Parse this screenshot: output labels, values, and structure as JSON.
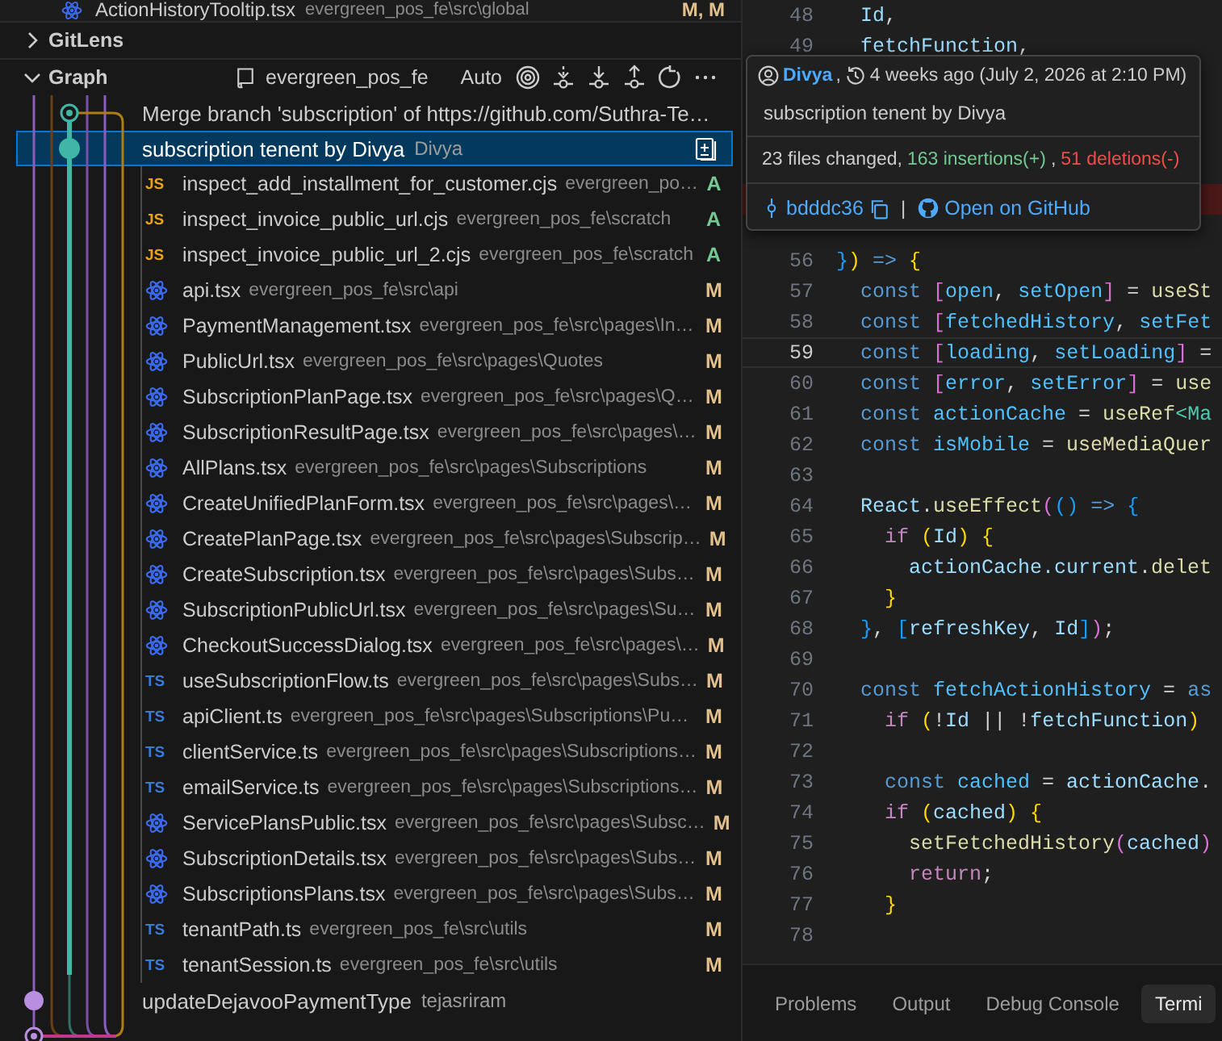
{
  "top_file": {
    "name": "ActionHistoryTooltip.tsx",
    "path": "evergreen_pos_fe\\src\\global",
    "status": "M, M"
  },
  "sections": [
    {
      "title": "GitLens",
      "expanded": false
    },
    {
      "title": "Graph",
      "expanded": true
    }
  ],
  "graph_toolbar": {
    "repo": "evergreen_pos_fe",
    "mode": "Auto"
  },
  "commits": [
    {
      "message": "Merge branch 'subscription' of https://github.com/Suthra-Te…",
      "selected": false
    },
    {
      "message": "subscription tenent by Divya",
      "author": "Divya",
      "selected": true,
      "files": [
        {
          "kind": "js",
          "badge": "JS",
          "name": "inspect_add_installment_for_customer.cjs",
          "path": "evergreen_po…",
          "status": "A"
        },
        {
          "kind": "js",
          "badge": "JS",
          "name": "inspect_invoice_public_url.cjs",
          "path": "evergreen_pos_fe\\scratch",
          "status": "A"
        },
        {
          "kind": "js",
          "badge": "JS",
          "name": "inspect_invoice_public_url_2.cjs",
          "path": "evergreen_pos_fe\\scratch",
          "status": "A"
        },
        {
          "kind": "react",
          "name": "api.tsx",
          "path": "evergreen_pos_fe\\src\\api",
          "status": "M"
        },
        {
          "kind": "react",
          "name": "PaymentManagement.tsx",
          "path": "evergreen_pos_fe\\src\\pages\\In…",
          "status": "M"
        },
        {
          "kind": "react",
          "name": "PublicUrl.tsx",
          "path": "evergreen_pos_fe\\src\\pages\\Quotes",
          "status": "M"
        },
        {
          "kind": "react",
          "name": "SubscriptionPlanPage.tsx",
          "path": "evergreen_pos_fe\\src\\pages\\Q…",
          "status": "M"
        },
        {
          "kind": "react",
          "name": "SubscriptionResultPage.tsx",
          "path": "evergreen_pos_fe\\src\\pages\\…",
          "status": "M"
        },
        {
          "kind": "react",
          "name": "AllPlans.tsx",
          "path": "evergreen_pos_fe\\src\\pages\\Subscriptions",
          "status": "M"
        },
        {
          "kind": "react",
          "name": "CreateUnifiedPlanForm.tsx",
          "path": "evergreen_pos_fe\\src\\pages\\…",
          "status": "M"
        },
        {
          "kind": "react",
          "name": "CreatePlanPage.tsx",
          "path": "evergreen_pos_fe\\src\\pages\\Subscrip…",
          "status": "M"
        },
        {
          "kind": "react",
          "name": "CreateSubscription.tsx",
          "path": "evergreen_pos_fe\\src\\pages\\Subs…",
          "status": "M"
        },
        {
          "kind": "react",
          "name": "SubscriptionPublicUrl.tsx",
          "path": "evergreen_pos_fe\\src\\pages\\Su…",
          "status": "M"
        },
        {
          "kind": "react",
          "name": "CheckoutSuccessDialog.tsx",
          "path": "evergreen_pos_fe\\src\\pages\\…",
          "status": "M"
        },
        {
          "kind": "ts",
          "badge": "TS",
          "name": "useSubscriptionFlow.ts",
          "path": "evergreen_pos_fe\\src\\pages\\Subs…",
          "status": "M"
        },
        {
          "kind": "ts",
          "badge": "TS",
          "name": "apiClient.ts",
          "path": "evergreen_pos_fe\\src\\pages\\Subscriptions\\Pu…",
          "status": "M"
        },
        {
          "kind": "ts",
          "badge": "TS",
          "name": "clientService.ts",
          "path": "evergreen_pos_fe\\src\\pages\\Subscriptions…",
          "status": "M"
        },
        {
          "kind": "ts",
          "badge": "TS",
          "name": "emailService.ts",
          "path": "evergreen_pos_fe\\src\\pages\\Subscriptions…",
          "status": "M"
        },
        {
          "kind": "react",
          "name": "ServicePlansPublic.tsx",
          "path": "evergreen_pos_fe\\src\\pages\\Subsc…",
          "status": "M"
        },
        {
          "kind": "react",
          "name": "SubscriptionDetails.tsx",
          "path": "evergreen_pos_fe\\src\\pages\\Subs…",
          "status": "M"
        },
        {
          "kind": "react",
          "name": "SubscriptionsPlans.tsx",
          "path": "evergreen_pos_fe\\src\\pages\\Subs…",
          "status": "M"
        },
        {
          "kind": "ts",
          "badge": "TS",
          "name": "tenantPath.ts",
          "path": "evergreen_pos_fe\\src\\utils",
          "status": "M"
        },
        {
          "kind": "ts",
          "badge": "TS",
          "name": "tenantSession.ts",
          "path": "evergreen_pos_fe\\src\\utils",
          "status": "M"
        }
      ]
    },
    {
      "message": "updateDejavooPaymentType",
      "author": "tejasriram",
      "selected": false
    }
  ],
  "editor": {
    "lines_before": [
      {
        "number": "48",
        "code": [
          {
            "text": "  Id",
            "kind": "var"
          },
          {
            "text": ",",
            "kind": "p"
          }
        ]
      },
      {
        "number": "49",
        "code": [
          {
            "text": "  fetchFunction",
            "kind": "var"
          },
          {
            "text": ",",
            "kind": "p"
          }
        ]
      }
    ],
    "covered_lines": [
      {
        "deleted": false
      },
      {
        "deleted": false
      },
      {
        "deleted": false
      },
      {
        "deleted": false
      },
      {
        "deleted": true
      },
      {
        "deleted": false
      }
    ],
    "lines_after": [
      {
        "number": "56",
        "current": false,
        "code": [
          {
            "text": "}",
            "kind": "b3"
          },
          {
            "text": ")",
            "kind": "b1"
          },
          {
            "text": " => ",
            "kind": "kw"
          },
          {
            "text": "{",
            "kind": "b1"
          }
        ]
      },
      {
        "number": "57",
        "current": false,
        "code": [
          {
            "text": "  const ",
            "kind": "kw"
          },
          {
            "text": "[",
            "kind": "b2"
          },
          {
            "text": "open",
            "kind": "cv"
          },
          {
            "text": ", ",
            "kind": "p"
          },
          {
            "text": "setOpen",
            "kind": "cv"
          },
          {
            "text": "]",
            "kind": "b2"
          },
          {
            "text": " = ",
            "kind": "p"
          },
          {
            "text": "useSt",
            "kind": "fn"
          }
        ]
      },
      {
        "number": "58",
        "current": false,
        "code": [
          {
            "text": "  const ",
            "kind": "kw"
          },
          {
            "text": "[",
            "kind": "b2"
          },
          {
            "text": "fetchedHistory",
            "kind": "cv"
          },
          {
            "text": ", ",
            "kind": "p"
          },
          {
            "text": "setFet",
            "kind": "cv"
          }
        ]
      },
      {
        "number": "59",
        "current": true,
        "code": [
          {
            "text": "  const ",
            "kind": "kw"
          },
          {
            "text": "[",
            "kind": "b2"
          },
          {
            "text": "loading",
            "kind": "cv"
          },
          {
            "text": ", ",
            "kind": "p"
          },
          {
            "text": "setLoading",
            "kind": "cv"
          },
          {
            "text": "]",
            "kind": "b2"
          },
          {
            "text": " =",
            "kind": "p"
          }
        ]
      },
      {
        "number": "60",
        "current": false,
        "code": [
          {
            "text": "  const ",
            "kind": "kw"
          },
          {
            "text": "[",
            "kind": "b2"
          },
          {
            "text": "error",
            "kind": "cv"
          },
          {
            "text": ", ",
            "kind": "p"
          },
          {
            "text": "setError",
            "kind": "cv"
          },
          {
            "text": "]",
            "kind": "b2"
          },
          {
            "text": " = ",
            "kind": "p"
          },
          {
            "text": "use",
            "kind": "fn"
          }
        ]
      },
      {
        "number": "61",
        "current": false,
        "code": [
          {
            "text": "  const ",
            "kind": "kw"
          },
          {
            "text": "actionCache",
            "kind": "cv"
          },
          {
            "text": " = ",
            "kind": "p"
          },
          {
            "text": "useRef",
            "kind": "fn"
          },
          {
            "text": "<Ma",
            "kind": "ty"
          }
        ]
      },
      {
        "number": "62",
        "current": false,
        "code": [
          {
            "text": "  const ",
            "kind": "kw"
          },
          {
            "text": "isMobile",
            "kind": "cv"
          },
          {
            "text": " = ",
            "kind": "p"
          },
          {
            "text": "useMediaQuer",
            "kind": "fn"
          }
        ]
      },
      {
        "number": "63",
        "current": false
      },
      {
        "number": "64",
        "current": false,
        "code": [
          {
            "text": "  React",
            "kind": "var"
          },
          {
            "text": ".",
            "kind": "p"
          },
          {
            "text": "useEffect",
            "kind": "fn"
          },
          {
            "text": "(",
            "kind": "b2"
          },
          {
            "text": "()",
            "kind": "b3"
          },
          {
            "text": " => ",
            "kind": "kw"
          },
          {
            "text": "{",
            "kind": "b3"
          }
        ]
      },
      {
        "number": "65",
        "current": false,
        "code": [
          {
            "text": "    if ",
            "kind": "ctl"
          },
          {
            "text": "(",
            "kind": "b1"
          },
          {
            "text": "Id",
            "kind": "var"
          },
          {
            "text": ") {",
            "kind": "b1"
          }
        ]
      },
      {
        "number": "66",
        "current": false,
        "code": [
          {
            "text": "      actionCache.current",
            "kind": "var"
          },
          {
            "text": ".",
            "kind": "p"
          },
          {
            "text": "delet",
            "kind": "fn"
          }
        ]
      },
      {
        "number": "67",
        "current": false,
        "code": [
          {
            "text": "    }",
            "kind": "b1"
          }
        ]
      },
      {
        "number": "68",
        "current": false,
        "code": [
          {
            "text": "  }",
            "kind": "b3"
          },
          {
            "text": ", ",
            "kind": "p"
          },
          {
            "text": "[",
            "kind": "b3"
          },
          {
            "text": "refreshKey",
            "kind": "var"
          },
          {
            "text": ", ",
            "kind": "p"
          },
          {
            "text": "Id",
            "kind": "var"
          },
          {
            "text": "]",
            "kind": "b3"
          },
          {
            "text": ")",
            "kind": "b2"
          },
          {
            "text": ";",
            "kind": "p"
          }
        ]
      },
      {
        "number": "69",
        "current": false
      },
      {
        "number": "70",
        "current": false,
        "code": [
          {
            "text": "  const ",
            "kind": "kw"
          },
          {
            "text": "fetchActionHistory",
            "kind": "cv"
          },
          {
            "text": " = ",
            "kind": "p"
          },
          {
            "text": "as",
            "kind": "kw"
          }
        ]
      },
      {
        "number": "71",
        "current": false,
        "code": [
          {
            "text": "    if ",
            "kind": "ctl"
          },
          {
            "text": "(",
            "kind": "b1"
          },
          {
            "text": "!",
            "kind": "p"
          },
          {
            "text": "Id",
            "kind": "var"
          },
          {
            "text": " || !",
            "kind": "p"
          },
          {
            "text": "fetchFunction",
            "kind": "var"
          },
          {
            "text": ")",
            "kind": "b1"
          }
        ]
      },
      {
        "number": "72",
        "current": false
      },
      {
        "number": "73",
        "current": false,
        "code": [
          {
            "text": "    const ",
            "kind": "kw"
          },
          {
            "text": "cached",
            "kind": "cv"
          },
          {
            "text": " = ",
            "kind": "p"
          },
          {
            "text": "actionCache",
            "kind": "var"
          },
          {
            "text": ".",
            "kind": "p"
          }
        ]
      },
      {
        "number": "74",
        "current": false,
        "code": [
          {
            "text": "    if ",
            "kind": "ctl"
          },
          {
            "text": "(",
            "kind": "b1"
          },
          {
            "text": "cached",
            "kind": "var"
          },
          {
            "text": ") {",
            "kind": "b1"
          }
        ]
      },
      {
        "number": "75",
        "current": false,
        "code": [
          {
            "text": "      setFetchedHistory",
            "kind": "fn"
          },
          {
            "text": "(",
            "kind": "b2"
          },
          {
            "text": "cached",
            "kind": "var"
          },
          {
            "text": ")",
            "kind": "b2"
          }
        ]
      },
      {
        "number": "76",
        "current": false,
        "code": [
          {
            "text": "      return",
            "kind": "ctl"
          },
          {
            "text": ";",
            "kind": "p"
          }
        ]
      },
      {
        "number": "77",
        "current": false,
        "code": [
          {
            "text": "    }",
            "kind": "b1"
          }
        ]
      },
      {
        "number": "78",
        "current": false
      }
    ]
  },
  "tooltip": {
    "author": "Divya",
    "author_suffix": ",",
    "date": "4 weeks ago (July 2, 2026 at 2:10 PM)",
    "message": "subscription tenent by Divya",
    "files_changed": "23 files changed,",
    "insertions": "163 insertions(+)",
    "stats_separator": ",",
    "deletions": "51 deletions(-)",
    "sha": "bdddc36",
    "divider": "|",
    "link": "Open on GitHub"
  },
  "panel_tabs": [
    {
      "label": "Problems",
      "selected": false
    },
    {
      "label": "Output",
      "selected": false
    },
    {
      "label": "Debug Console",
      "selected": false
    },
    {
      "label": "Termi",
      "selected": true
    }
  ]
}
